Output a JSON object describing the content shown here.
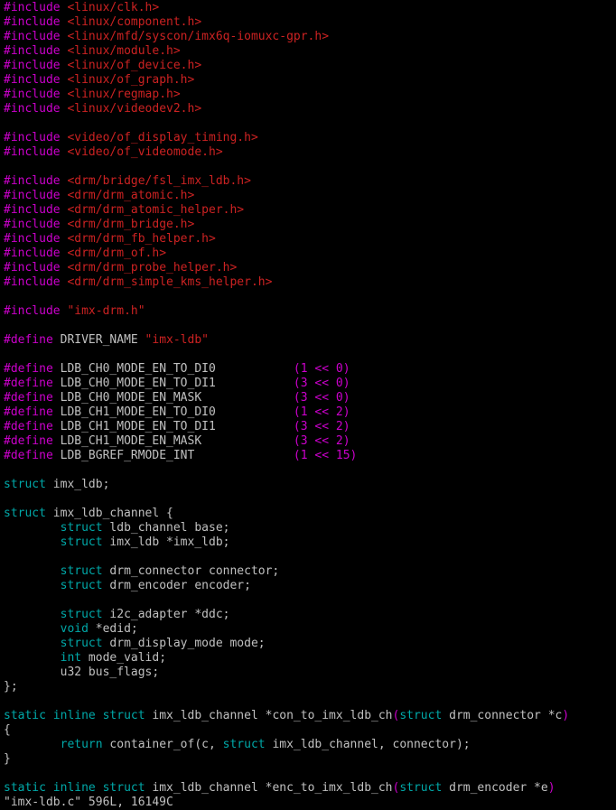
{
  "colors": {
    "background": "#000000",
    "text": "#c0c0c0",
    "preproc": "#cc00cc",
    "string": "#cc2222",
    "keyword": "#00a8a8",
    "number": "#cc00cc",
    "paren": "#cc00cc"
  },
  "lines": [
    {
      "segments": [
        {
          "text": "#include ",
          "type": "preproc"
        },
        {
          "text": "<linux/clk.h>",
          "type": "string"
        }
      ]
    },
    {
      "segments": [
        {
          "text": "#include ",
          "type": "preproc"
        },
        {
          "text": "<linux/component.h>",
          "type": "string"
        }
      ]
    },
    {
      "segments": [
        {
          "text": "#include ",
          "type": "preproc"
        },
        {
          "text": "<linux/mfd/syscon/imx6q-iomuxc-gpr.h>",
          "type": "string"
        }
      ]
    },
    {
      "segments": [
        {
          "text": "#include ",
          "type": "preproc"
        },
        {
          "text": "<linux/module.h>",
          "type": "string"
        }
      ]
    },
    {
      "segments": [
        {
          "text": "#include ",
          "type": "preproc"
        },
        {
          "text": "<linux/of_device.h>",
          "type": "string"
        }
      ]
    },
    {
      "segments": [
        {
          "text": "#include ",
          "type": "preproc"
        },
        {
          "text": "<linux/of_graph.h>",
          "type": "string"
        }
      ]
    },
    {
      "segments": [
        {
          "text": "#include ",
          "type": "preproc"
        },
        {
          "text": "<linux/regmap.h>",
          "type": "string"
        }
      ]
    },
    {
      "segments": [
        {
          "text": "#include ",
          "type": "preproc"
        },
        {
          "text": "<linux/videodev2.h>",
          "type": "string"
        }
      ]
    },
    {
      "segments": []
    },
    {
      "segments": [
        {
          "text": "#include ",
          "type": "preproc"
        },
        {
          "text": "<video/of_display_timing.h>",
          "type": "string"
        }
      ]
    },
    {
      "segments": [
        {
          "text": "#include ",
          "type": "preproc"
        },
        {
          "text": "<video/of_videomode.h>",
          "type": "string"
        }
      ]
    },
    {
      "segments": []
    },
    {
      "segments": [
        {
          "text": "#include ",
          "type": "preproc"
        },
        {
          "text": "<drm/bridge/fsl_imx_ldb.h>",
          "type": "string"
        }
      ]
    },
    {
      "segments": [
        {
          "text": "#include ",
          "type": "preproc"
        },
        {
          "text": "<drm/drm_atomic.h>",
          "type": "string"
        }
      ]
    },
    {
      "segments": [
        {
          "text": "#include ",
          "type": "preproc"
        },
        {
          "text": "<drm/drm_atomic_helper.h>",
          "type": "string"
        }
      ]
    },
    {
      "segments": [
        {
          "text": "#include ",
          "type": "preproc"
        },
        {
          "text": "<drm/drm_bridge.h>",
          "type": "string"
        }
      ]
    },
    {
      "segments": [
        {
          "text": "#include ",
          "type": "preproc"
        },
        {
          "text": "<drm/drm_fb_helper.h>",
          "type": "string"
        }
      ]
    },
    {
      "segments": [
        {
          "text": "#include ",
          "type": "preproc"
        },
        {
          "text": "<drm/drm_of.h>",
          "type": "string"
        }
      ]
    },
    {
      "segments": [
        {
          "text": "#include ",
          "type": "preproc"
        },
        {
          "text": "<drm/drm_probe_helper.h>",
          "type": "string"
        }
      ]
    },
    {
      "segments": [
        {
          "text": "#include ",
          "type": "preproc"
        },
        {
          "text": "<drm/drm_simple_kms_helper.h>",
          "type": "string"
        }
      ]
    },
    {
      "segments": []
    },
    {
      "segments": [
        {
          "text": "#include ",
          "type": "preproc"
        },
        {
          "text": "\"imx-drm.h\"",
          "type": "string"
        }
      ]
    },
    {
      "segments": []
    },
    {
      "segments": [
        {
          "text": "#define ",
          "type": "preproc"
        },
        {
          "text": "DRIVER_NAME ",
          "type": "text"
        },
        {
          "text": "\"imx-ldb\"",
          "type": "string"
        }
      ]
    },
    {
      "segments": []
    },
    {
      "segments": [
        {
          "text": "#define ",
          "type": "preproc"
        },
        {
          "text": "LDB_CH0_MODE_EN_TO_DI0           ",
          "type": "text"
        },
        {
          "text": "(1 << 0)",
          "type": "number"
        }
      ]
    },
    {
      "segments": [
        {
          "text": "#define ",
          "type": "preproc"
        },
        {
          "text": "LDB_CH0_MODE_EN_TO_DI1           ",
          "type": "text"
        },
        {
          "text": "(3 << 0)",
          "type": "number"
        }
      ]
    },
    {
      "segments": [
        {
          "text": "#define ",
          "type": "preproc"
        },
        {
          "text": "LDB_CH0_MODE_EN_MASK             ",
          "type": "text"
        },
        {
          "text": "(3 << 0)",
          "type": "number"
        }
      ]
    },
    {
      "segments": [
        {
          "text": "#define ",
          "type": "preproc"
        },
        {
          "text": "LDB_CH1_MODE_EN_TO_DI0           ",
          "type": "text"
        },
        {
          "text": "(1 << 2)",
          "type": "number"
        }
      ]
    },
    {
      "segments": [
        {
          "text": "#define ",
          "type": "preproc"
        },
        {
          "text": "LDB_CH1_MODE_EN_TO_DI1           ",
          "type": "text"
        },
        {
          "text": "(3 << 2)",
          "type": "number"
        }
      ]
    },
    {
      "segments": [
        {
          "text": "#define ",
          "type": "preproc"
        },
        {
          "text": "LDB_CH1_MODE_EN_MASK             ",
          "type": "text"
        },
        {
          "text": "(3 << 2)",
          "type": "number"
        }
      ]
    },
    {
      "segments": [
        {
          "text": "#define ",
          "type": "preproc"
        },
        {
          "text": "LDB_BGREF_RMODE_INT              ",
          "type": "text"
        },
        {
          "text": "(1 << 15)",
          "type": "number"
        }
      ]
    },
    {
      "segments": []
    },
    {
      "segments": [
        {
          "text": "struct",
          "type": "keyword"
        },
        {
          "text": " imx_ldb;",
          "type": "text"
        }
      ]
    },
    {
      "segments": []
    },
    {
      "segments": [
        {
          "text": "struct",
          "type": "keyword"
        },
        {
          "text": " imx_ldb_channel {",
          "type": "text"
        }
      ]
    },
    {
      "segments": [
        {
          "text": "        ",
          "type": "text"
        },
        {
          "text": "struct",
          "type": "keyword"
        },
        {
          "text": " ldb_channel base;",
          "type": "text"
        }
      ]
    },
    {
      "segments": [
        {
          "text": "        ",
          "type": "text"
        },
        {
          "text": "struct",
          "type": "keyword"
        },
        {
          "text": " imx_ldb *imx_ldb;",
          "type": "text"
        }
      ]
    },
    {
      "segments": []
    },
    {
      "segments": [
        {
          "text": "        ",
          "type": "text"
        },
        {
          "text": "struct",
          "type": "keyword"
        },
        {
          "text": " drm_connector connector;",
          "type": "text"
        }
      ]
    },
    {
      "segments": [
        {
          "text": "        ",
          "type": "text"
        },
        {
          "text": "struct",
          "type": "keyword"
        },
        {
          "text": " drm_encoder encoder;",
          "type": "text"
        }
      ]
    },
    {
      "segments": []
    },
    {
      "segments": [
        {
          "text": "        ",
          "type": "text"
        },
        {
          "text": "struct",
          "type": "keyword"
        },
        {
          "text": " i2c_adapter *ddc;",
          "type": "text"
        }
      ]
    },
    {
      "segments": [
        {
          "text": "        ",
          "type": "text"
        },
        {
          "text": "void",
          "type": "keyword"
        },
        {
          "text": " *edid;",
          "type": "text"
        }
      ]
    },
    {
      "segments": [
        {
          "text": "        ",
          "type": "text"
        },
        {
          "text": "struct",
          "type": "keyword"
        },
        {
          "text": " drm_display_mode mode;",
          "type": "text"
        }
      ]
    },
    {
      "segments": [
        {
          "text": "        ",
          "type": "text"
        },
        {
          "text": "int",
          "type": "keyword"
        },
        {
          "text": " mode_valid;",
          "type": "text"
        }
      ]
    },
    {
      "segments": [
        {
          "text": "        u32 bus_flags;",
          "type": "text"
        }
      ]
    },
    {
      "segments": [
        {
          "text": "};",
          "type": "text"
        }
      ]
    },
    {
      "segments": []
    },
    {
      "segments": [
        {
          "text": "static",
          "type": "keyword"
        },
        {
          "text": " ",
          "type": "text"
        },
        {
          "text": "inline",
          "type": "keyword"
        },
        {
          "text": " ",
          "type": "text"
        },
        {
          "text": "struct",
          "type": "keyword"
        },
        {
          "text": " imx_ldb_channel *con_to_imx_ldb_ch",
          "type": "text"
        },
        {
          "text": "(",
          "type": "paren"
        },
        {
          "text": "struct",
          "type": "keyword"
        },
        {
          "text": " drm_connector *c",
          "type": "text"
        },
        {
          "text": ")",
          "type": "paren"
        }
      ]
    },
    {
      "segments": [
        {
          "text": "{",
          "type": "text"
        }
      ]
    },
    {
      "segments": [
        {
          "text": "        ",
          "type": "text"
        },
        {
          "text": "return",
          "type": "keyword"
        },
        {
          "text": " container_of(c, ",
          "type": "text"
        },
        {
          "text": "struct",
          "type": "keyword"
        },
        {
          "text": " imx_ldb_channel, connector);",
          "type": "text"
        }
      ]
    },
    {
      "segments": [
        {
          "text": "}",
          "type": "text"
        }
      ]
    },
    {
      "segments": []
    },
    {
      "segments": [
        {
          "text": "static",
          "type": "keyword"
        },
        {
          "text": " ",
          "type": "text"
        },
        {
          "text": "inline",
          "type": "keyword"
        },
        {
          "text": " ",
          "type": "text"
        },
        {
          "text": "struct",
          "type": "keyword"
        },
        {
          "text": " imx_ldb_channel *enc_to_imx_ldb_ch",
          "type": "text"
        },
        {
          "text": "(",
          "type": "paren"
        },
        {
          "text": "struct",
          "type": "keyword"
        },
        {
          "text": " drm_encoder *e",
          "type": "text"
        },
        {
          "text": ")",
          "type": "paren"
        }
      ]
    }
  ],
  "status_line": "\"imx-ldb.c\" 596L, 16149C"
}
